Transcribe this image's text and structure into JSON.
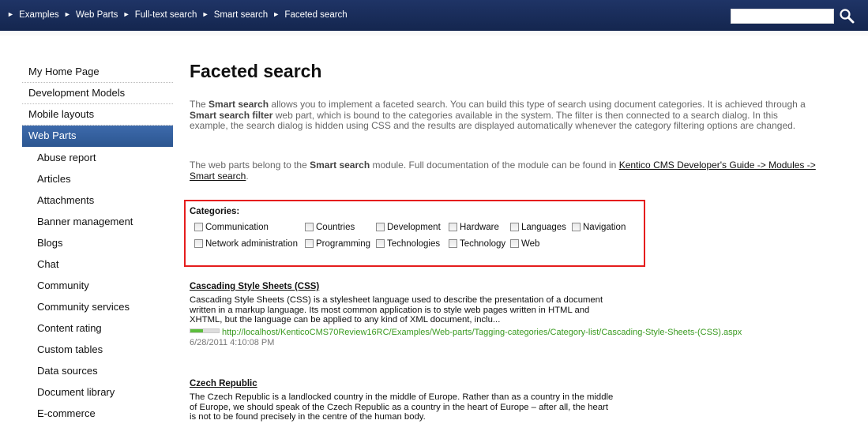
{
  "breadcrumb": [
    "Examples",
    "Web Parts",
    "Full-text search",
    "Smart search",
    "Faceted search"
  ],
  "breadcrumb_separator": "►",
  "search": {
    "value": "",
    "placeholder": ""
  },
  "nav": {
    "items": [
      "My Home Page",
      "Development Models",
      "Mobile layouts",
      "Web Parts"
    ],
    "active": "Web Parts",
    "sub_items": [
      "Abuse report",
      "Articles",
      "Attachments",
      "Banner management",
      "Blogs",
      "Chat",
      "Community",
      "Community services",
      "Content rating",
      "Custom tables",
      "Data sources",
      "Document library",
      "E-commerce"
    ]
  },
  "page": {
    "title": "Faceted search",
    "intro": {
      "p1": "The ",
      "b1": "Smart search",
      "p2": " allows you to implement a faceted search. You can build this type of search using document categories. It is achieved through a ",
      "b2": "Smart search filter",
      "p3": " web part, which is bound to the categories available in the system. The filter is then connected to a search dialog. In this example, the search dialog is hidden using CSS and the results are displayed automatically whenever the category filtering options are changed."
    },
    "intro2": {
      "p1": "The web parts belong to the ",
      "b1": "Smart search",
      "p2": " module. Full documentation of the module can be found in ",
      "link": "Kentico CMS Developer's Guide -> Modules -> Smart search",
      "p3": "."
    }
  },
  "categories": {
    "label": "Categories:",
    "row1": [
      "Communication",
      "Countries",
      "Development",
      "Hardware",
      "Languages",
      "Navigation"
    ],
    "row2": [
      "Network administration",
      "Programming",
      "Technologies",
      "Technology",
      "Web"
    ]
  },
  "results": [
    {
      "title": "Cascading Style Sheets (CSS)",
      "description": "Cascading Style Sheets (CSS) is a stylesheet language used to describe the presentation of a document written in a markup language. Its most common application is to style web pages written in HTML and XHTML, but the language can be applied to any kind of XML document, inclu...",
      "url": "http://localhost/KenticoCMS70Review16RC/Examples/Web-parts/Tagging-categories/Category-list/Cascading-Style-Sheets-(CSS).aspx",
      "relevance": 0.45,
      "date": "6/28/2011 4:10:08 PM"
    },
    {
      "title": "Czech Republic",
      "description": "The Czech Republic is a landlocked country in the middle of Europe. Rather than as a country in the middle of Europe, we should speak of the Czech Republic as a country in the heart of Europe – after all, the heart is not to be found precisely in the centre of the human body."
    }
  ],
  "colors": {
    "header_bg": "#1b2f5e",
    "active_nav": "#3563a2",
    "highlight_border": "#e51d1d",
    "url_green": "#3a9a20"
  }
}
